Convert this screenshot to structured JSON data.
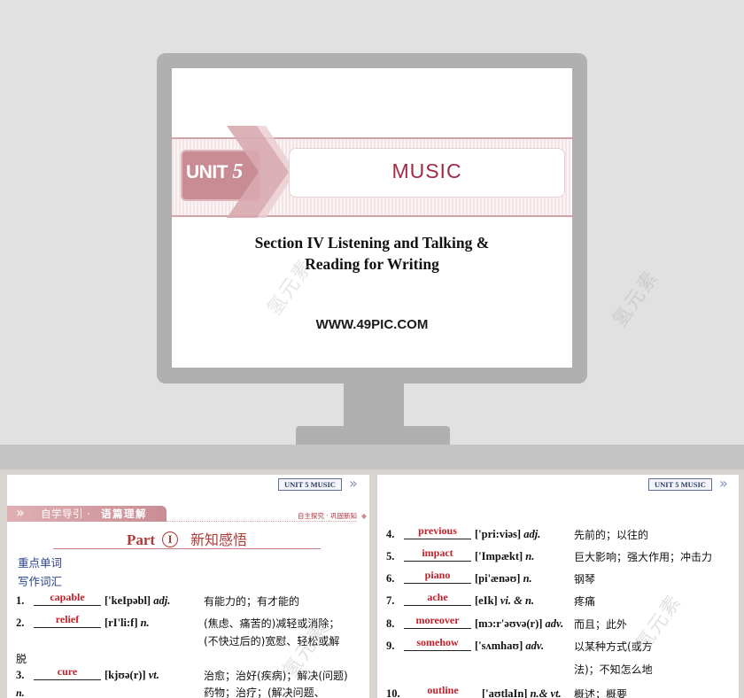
{
  "preview_slide": {
    "unit_word": "UNIT",
    "unit_number": "5",
    "unit_title": "MUSIC",
    "section_title_line1": "Section IV Listening and Talking &",
    "section_title_line2": "Reading for Writing",
    "website": "WWW.49PIC.COM",
    "watermark": "氢元素"
  },
  "thumbnails": {
    "unit_tag": "UNIT 5    MUSIC",
    "left": {
      "nav_prefix": "自学导引 ·",
      "nav_highlight": "语篇理解",
      "nav_right": "自主探究 · 巩固新知",
      "part_word": "Part",
      "part_number": "I",
      "part_cn": "新知感悟",
      "heading1": "重点单词",
      "heading2": "写作词汇",
      "entries": [
        {
          "num": "1.",
          "answer": "capable",
          "phonetic": "['keIpəbl]",
          "pos": "adj.",
          "meaning": "有能力的；有才能的"
        },
        {
          "num": "2.",
          "answer": "relief",
          "phonetic": "[rI'li:f]",
          "pos": "n.",
          "meaning": "(焦虑、痛苦的)减轻或消除；",
          "meaning_cont": "(不快过后的)宽慰、轻松或解",
          "meaning_cont2": "脱"
        },
        {
          "num": "3.",
          "answer": "cure",
          "phonetic": "[kjʊə(r)]",
          "pos": "vt.",
          "meaning": "治愈；治好(疾病)；解决(问题)",
          "extra_pos": "n.",
          "meaning_cont": "药物；治疗；(解决问题、"
        }
      ]
    },
    "right": {
      "entries": [
        {
          "num": "4.",
          "answer": "previous",
          "phonetic": "['pri:viəs]",
          "pos": "adj.",
          "meaning": "先前的；以往的"
        },
        {
          "num": "5.",
          "answer": "impact",
          "phonetic": "['Impækt]",
          "pos": "n.",
          "meaning": "巨大影响；强大作用；冲击力"
        },
        {
          "num": "6.",
          "answer": "piano",
          "phonetic": "[pi'ænəʊ]",
          "pos": "n.",
          "meaning": "钢琴"
        },
        {
          "num": "7.",
          "answer": "ache",
          "phonetic": "[eIk]",
          "pos": "vi. & n.",
          "meaning": "疼痛"
        },
        {
          "num": "8.",
          "answer": "moreover",
          "phonetic": "[mɔ:r'əʊvə(r)]",
          "pos": "adv.",
          "meaning": "而且；此外"
        },
        {
          "num": "9.",
          "answer": "somehow",
          "phonetic": "['sʌmhaʊ]",
          "pos": "adv.",
          "meaning": "以某种方式(或方",
          "meaning_cont": "法)；不知怎么地"
        },
        {
          "num": "10.",
          "answer": "outline",
          "phonetic": "['aʊtlaIn]",
          "pos": "n.& vt.",
          "meaning": "概述；概要"
        }
      ]
    }
  }
}
